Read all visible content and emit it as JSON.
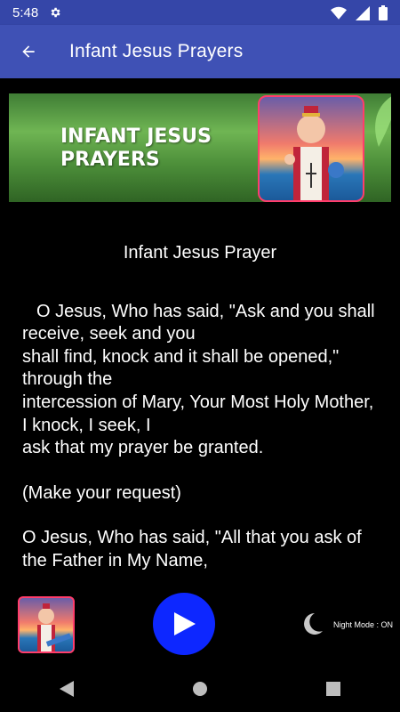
{
  "status_bar": {
    "time": "5:48",
    "icons": [
      "settings-gear-icon",
      "wifi-icon",
      "signal-icon",
      "battery-icon"
    ]
  },
  "app_bar": {
    "title": "Infant Jesus Prayers",
    "back_icon": "arrow-back-icon",
    "color": "#3f51b5"
  },
  "banner": {
    "line1": "INFANT JESUS",
    "line2": "PRAYERS"
  },
  "content": {
    "title": "Infant Jesus Prayer",
    "paragraphs": [
      "O Jesus, Who has said, \"Ask and you shall receive, seek and you\nshall find, knock and it shall be opened,\" through the\nintercession of Mary, Your Most Holy Mother, I knock, I seek, I\nask that my prayer be granted.",
      "(Make your request)",
      "O Jesus, Who has said, \"All that you ask of the Father in My Name,"
    ]
  },
  "player": {
    "play_icon": "play-icon",
    "play_color": "#0d27ff",
    "night_mode_icon": "moon-icon",
    "night_mode_label": "Night Mode : ON"
  },
  "nav_bar": {
    "items": [
      "back-triangle-icon",
      "home-circle-icon",
      "recents-square-icon"
    ]
  }
}
